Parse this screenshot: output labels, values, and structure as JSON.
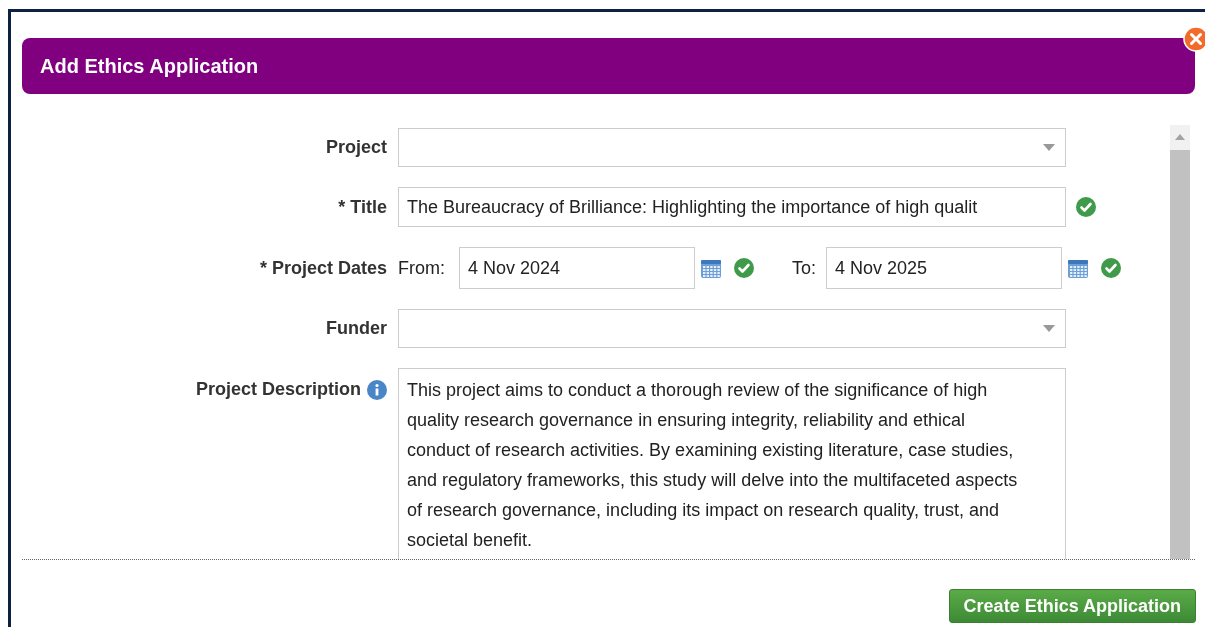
{
  "dialog": {
    "title": "Add Ethics Application"
  },
  "fields": [
    {
      "kind": "select",
      "label": "Project"
    },
    {
      "kind": "text",
      "label": "* Title",
      "value": "The Bureaucracy of Brilliance: Highlighting the importance of high qualit",
      "valid": true
    },
    {
      "kind": "daterange",
      "label": "* Project Dates",
      "from_label": "From:",
      "from": "4 Nov 2024",
      "from_valid": true,
      "to_label": "To:",
      "to": "4 Nov 2025",
      "to_valid": true
    },
    {
      "kind": "select",
      "label": "Funder"
    },
    {
      "kind": "textarea",
      "label": "Project Description",
      "info": true,
      "value": "This project aims to conduct a thorough review of the significance of high quality research governance in ensuring integrity, reliability and ethical conduct of research activities. By examining existing literature, case studies, and regulatory frameworks, this study will delve into the multifaceted aspects of research governance, including its impact on research quality, trust, and societal benefit."
    }
  ],
  "submit": {
    "label": "Create Ethics Application"
  }
}
